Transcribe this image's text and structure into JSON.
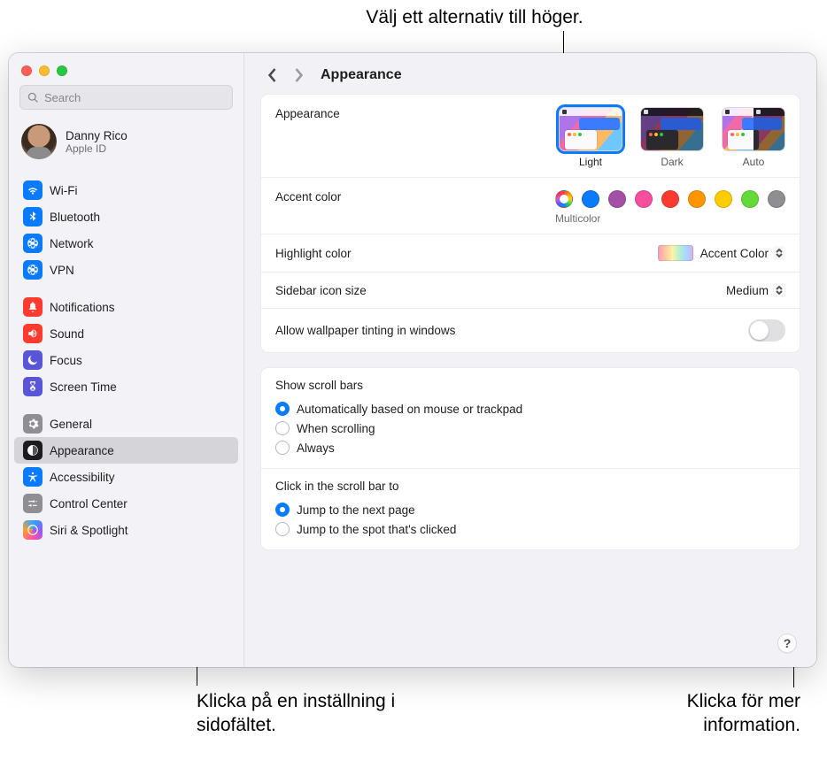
{
  "callouts": {
    "top": "Välj ett alternativ till höger.",
    "bottom_left_l1": "Klicka på en inställning i",
    "bottom_left_l2": "sidofältet.",
    "bottom_right_l1": "Klicka för mer",
    "bottom_right_l2": "information."
  },
  "sidebar": {
    "search_placeholder": "Search",
    "user": {
      "name": "Danny Rico",
      "sub": "Apple ID"
    },
    "group1": [
      {
        "label": "Wi-Fi",
        "icon": "wifi",
        "color": "c-blue"
      },
      {
        "label": "Bluetooth",
        "icon": "bluetooth",
        "color": "c-blue"
      },
      {
        "label": "Network",
        "icon": "globe",
        "color": "c-blue"
      },
      {
        "label": "VPN",
        "icon": "globe",
        "color": "c-blue"
      }
    ],
    "group2": [
      {
        "label": "Notifications",
        "icon": "bell",
        "color": "c-red"
      },
      {
        "label": "Sound",
        "icon": "speaker",
        "color": "c-red"
      },
      {
        "label": "Focus",
        "icon": "moon",
        "color": "c-purple"
      },
      {
        "label": "Screen Time",
        "icon": "hourglass",
        "color": "c-purple"
      }
    ],
    "group3": [
      {
        "label": "General",
        "icon": "gear",
        "color": "c-gray"
      },
      {
        "label": "Appearance",
        "icon": "appearance",
        "color": "c-black",
        "selected": true
      },
      {
        "label": "Accessibility",
        "icon": "accessibility",
        "color": "c-blue"
      },
      {
        "label": "Control Center",
        "icon": "sliders",
        "color": "c-gray"
      },
      {
        "label": "Siri & Spotlight",
        "icon": "siri",
        "color": "siri"
      }
    ]
  },
  "header": {
    "title": "Appearance"
  },
  "appearance_row": {
    "label": "Appearance",
    "options": {
      "light": "Light",
      "dark": "Dark",
      "auto": "Auto"
    },
    "selected": "light"
  },
  "accent": {
    "label": "Accent color",
    "selected_name": "Multicolor",
    "colors": [
      "multi",
      "#0a7aff",
      "#a550a7",
      "#f74f9e",
      "#ff3b30",
      "#ff9500",
      "#ffcc00",
      "#63da38",
      "#8e8e93"
    ]
  },
  "highlight": {
    "label": "Highlight color",
    "value": "Accent Color"
  },
  "sidebar_size": {
    "label": "Sidebar icon size",
    "value": "Medium"
  },
  "tinting": {
    "label": "Allow wallpaper tinting in windows",
    "on": false
  },
  "scrollbars": {
    "title": "Show scroll bars",
    "opts": [
      "Automatically based on mouse or trackpad",
      "When scrolling",
      "Always"
    ],
    "selected": 0
  },
  "scrollclick": {
    "title": "Click in the scroll bar to",
    "opts": [
      "Jump to the next page",
      "Jump to the spot that's clicked"
    ],
    "selected": 0
  },
  "help": "?"
}
